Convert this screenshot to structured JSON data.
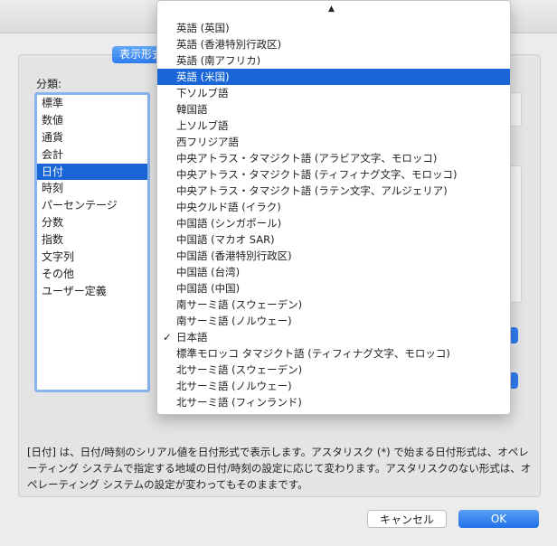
{
  "categories": {
    "label": "分類:",
    "items": [
      "標準",
      "数値",
      "通貨",
      "会計",
      "日付",
      "時刻",
      "パーセンテージ",
      "分数",
      "指数",
      "文字列",
      "その他",
      "ユーザー定義"
    ],
    "selected_index": 4
  },
  "tab": {
    "label": "表示形式"
  },
  "dropdown": {
    "scroll_up_icon": "▲",
    "items": [
      "英語 (英国)",
      "英語 (香港特別行政区)",
      "英語 (南アフリカ)",
      "英語 (米国)",
      "下ソルブ語",
      "韓国語",
      "上ソルブ語",
      "西フリジア語",
      "中央アトラス・タマジクト語 (アラビア文字、モロッコ)",
      "中央アトラス・タマジクト語 (ティフィナグ文字、モロッコ)",
      "中央アトラス・タマジクト語 (ラテン文字、アルジェリア)",
      "中央クルド語 (イラク)",
      "中国語 (シンガポール)",
      "中国語 (マカオ SAR)",
      "中国語 (香港特別行政区)",
      "中国語 (台湾)",
      "中国語 (中国)",
      "南サーミ語 (スウェーデン)",
      "南サーミ語 (ノルウェー)",
      "日本語",
      "標準モロッコ タマジクト語 (ティフィナグ文字、モロッコ)",
      "北サーミ語 (スウェーデン)",
      "北サーミ語 (ノルウェー)",
      "北サーミ語 (フィンランド)"
    ],
    "highlighted_index": 3,
    "checked_index": 19,
    "check_glyph": "✓"
  },
  "description": "[日付] は、日付/時刻のシリアル値を日付形式で表示します。アスタリスク (*) で始まる日付形式は、オペレーティング システムで指定する地域の日付/時刻の設定に応じて変わります。アスタリスクのない形式は、オペレーティング システムの設定が変わってもそのままです。",
  "buttons": {
    "cancel": "キャンセル",
    "ok": "OK"
  }
}
